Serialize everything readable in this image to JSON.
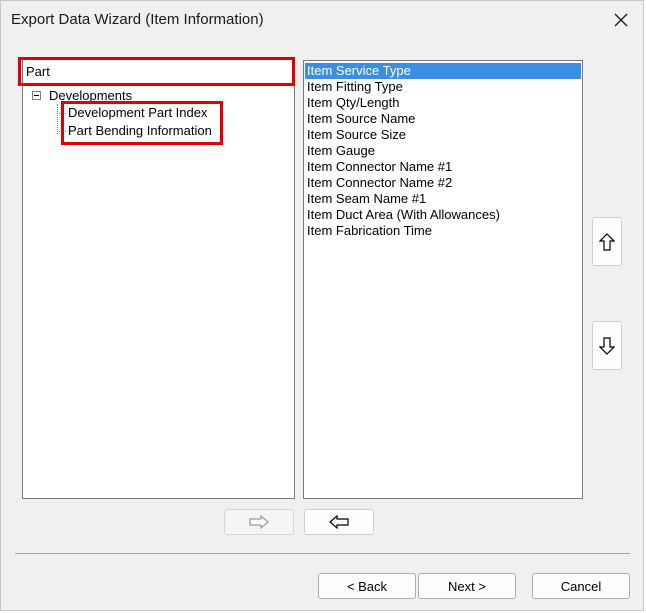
{
  "window": {
    "title": "Export Data Wizard (Item Information)"
  },
  "tree": {
    "root_label": "Part",
    "group_label": "Developments",
    "children": [
      "Development Part Index",
      "Part Bending Information"
    ]
  },
  "fields": {
    "items": [
      "Item Service Type",
      "Item Fitting Type",
      "Item Qty/Length",
      "Item Source Name",
      "Item Source Size",
      "Item Gauge",
      "Item Connector Name #1",
      "Item Connector Name #2",
      "Item Seam Name #1",
      "Item Duct Area (With Allowances)",
      "Item Fabrication Time"
    ],
    "selected_index": 0
  },
  "buttons": {
    "back": "< Back",
    "next": "Next >",
    "cancel": "Cancel"
  },
  "icons": {
    "close": "close-icon",
    "move_up": "arrow-up-icon",
    "move_down": "arrow-down-icon",
    "add": "arrow-right-icon",
    "remove": "arrow-left-icon"
  },
  "colors": {
    "selection": "#3a8ee6",
    "highlight_box": "#e00000"
  }
}
